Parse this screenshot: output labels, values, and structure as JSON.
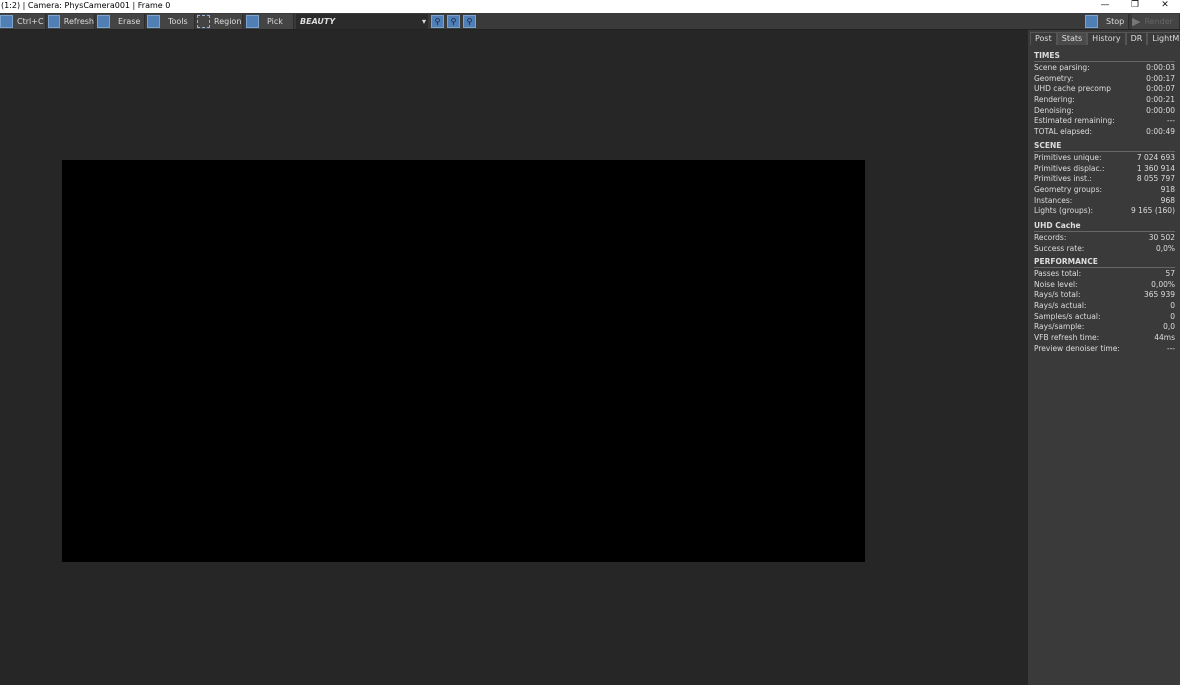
{
  "title": "(1:2) | Camera: PhysCamera001 | Frame 0",
  "window": {
    "minimize": "—",
    "restore": "❐",
    "close": "✕"
  },
  "toolbar": {
    "copy": "Ctrl+C",
    "refresh": "Refresh",
    "erase": "Erase",
    "tools": "Tools",
    "region": "Region",
    "pick": "Pick",
    "channel": "BEAUTY",
    "stop": "Stop",
    "render": "Render"
  },
  "tabs": [
    "Post",
    "Stats",
    "History",
    "DR",
    "LightMix"
  ],
  "active_tab": "Stats",
  "sections": [
    {
      "title": "TIMES",
      "rows": [
        [
          "Scene parsing:",
          "0:00:03"
        ],
        [
          "Geometry:",
          "0:00:17"
        ],
        [
          "UHD cache precomp",
          "0:00:07"
        ],
        [
          "Rendering:",
          "0:00:21"
        ],
        [
          "Denoising:",
          "0:00:00"
        ],
        [
          "Estimated remaining:",
          "---"
        ],
        [
          "TOTAL elapsed:",
          "0:00:49"
        ]
      ]
    },
    {
      "title": "SCENE",
      "rows": [
        [
          "Primitives unique:",
          "7 024 693"
        ],
        [
          "Primitives displac.:",
          "1 360 914"
        ],
        [
          "Primitives inst.:",
          "8 055 797"
        ],
        [
          "Geometry groups:",
          "918"
        ],
        [
          "Instances:",
          "968"
        ],
        [
          "Lights (groups):",
          "9 165 (160)"
        ]
      ]
    },
    {
      "title": "UHD Cache",
      "rows": [
        [
          "Records:",
          "30 502"
        ],
        [
          "Success rate:",
          "0,0%"
        ]
      ]
    },
    {
      "title": "PERFORMANCE",
      "rows": [
        [
          "Passes total:",
          "57"
        ],
        [
          "Noise level:",
          "0,00%"
        ],
        [
          "Rays/s total:",
          "365 939"
        ],
        [
          "Rays/s actual:",
          "0"
        ],
        [
          "Samples/s actual:",
          "0"
        ],
        [
          "Rays/sample:",
          "0,0"
        ],
        [
          "VFB refresh time:",
          "44ms"
        ],
        [
          "Preview denoiser time:",
          "---"
        ]
      ]
    }
  ]
}
